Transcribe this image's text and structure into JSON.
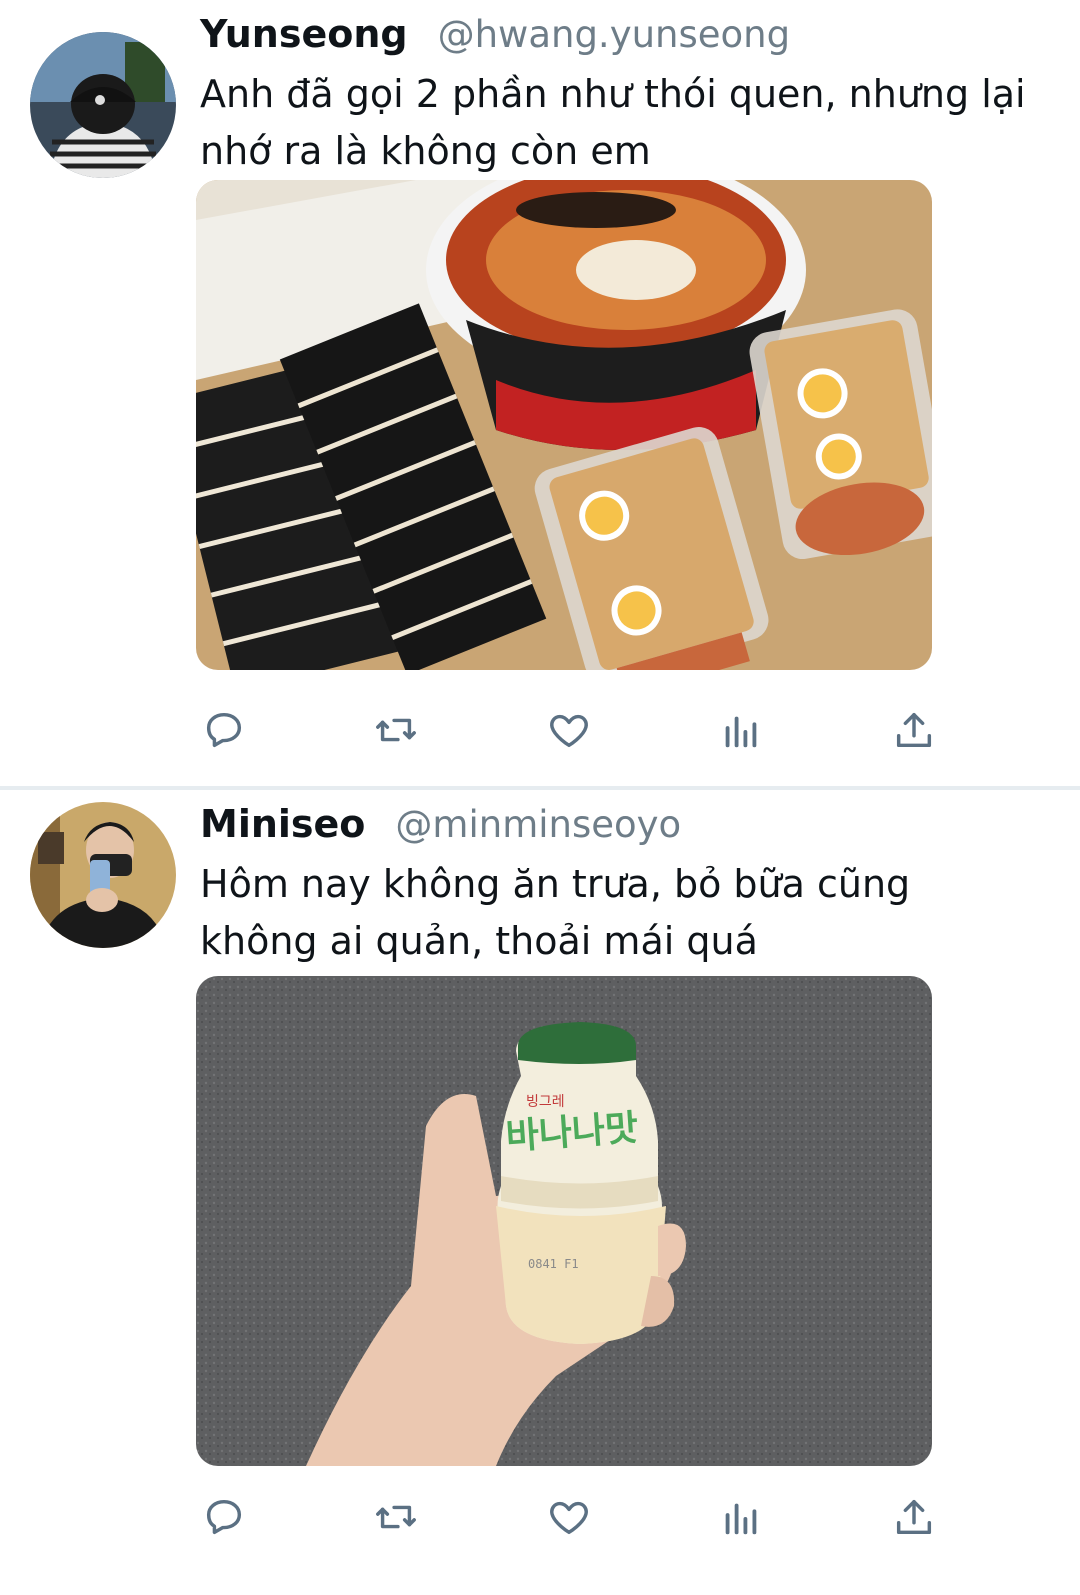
{
  "tweets": [
    {
      "name": "Yunseong",
      "handle": "@hwang.yunseong",
      "text": "Anh đã gọi 2 phần như thói quen, nhưng lại nhớ ra là không còn em",
      "media_description_icon": "food-photo",
      "actions": [
        "reply-icon",
        "retweet-icon",
        "like-icon",
        "analytics-icon",
        "share-icon"
      ]
    },
    {
      "name": "Miniseo",
      "handle": "@minminseoyo",
      "text": "Hôm nay không ăn trưa, bỏ bữa cũng không ai quản, thoải mái quá",
      "media_description_icon": "drink-photo",
      "actions": [
        "reply-icon",
        "retweet-icon",
        "like-icon",
        "analytics-icon",
        "share-icon"
      ]
    }
  ],
  "colors": {
    "text": "#0f1419",
    "secondary": "#6e7d88",
    "icon": "#5b7083",
    "divider": "#e6ecf0"
  }
}
